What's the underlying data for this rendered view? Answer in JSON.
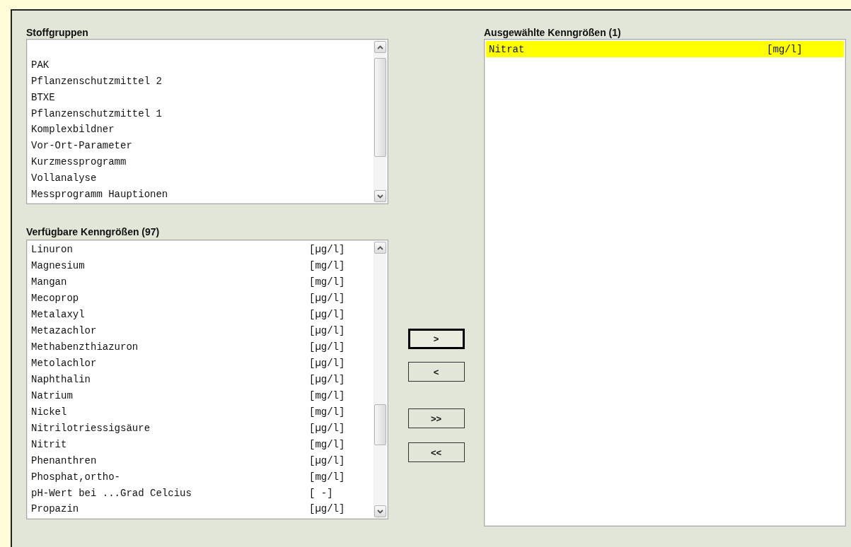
{
  "groups": {
    "title": "Stoffgruppen",
    "items": [
      {
        "name": "PAK",
        "selected": false
      },
      {
        "name": "Pflanzenschutzmittel 2",
        "selected": false
      },
      {
        "name": "BTXE",
        "selected": false
      },
      {
        "name": "Pflanzenschutzmittel 1",
        "selected": false
      },
      {
        "name": "Komplexbildner",
        "selected": false
      },
      {
        "name": "Vor-Ort-Parameter",
        "selected": false
      },
      {
        "name": "Kurzmessprogramm",
        "selected": false
      },
      {
        "name": "Vollanalyse",
        "selected": false
      },
      {
        "name": "Messprogramm Hauptionen",
        "selected": false
      }
    ]
  },
  "available": {
    "title": "Verfügbare Kenngrößen (97)",
    "items": [
      {
        "name": "Linuron",
        "unit": "[µg/l]",
        "selected": false
      },
      {
        "name": "Magnesium",
        "unit": "[mg/l]",
        "selected": false
      },
      {
        "name": "Mangan",
        "unit": "[mg/l]",
        "selected": false
      },
      {
        "name": "Mecoprop",
        "unit": "[µg/l]",
        "selected": false
      },
      {
        "name": "Metalaxyl",
        "unit": "[µg/l]",
        "selected": false
      },
      {
        "name": "Metazachlor",
        "unit": "[µg/l]",
        "selected": false
      },
      {
        "name": "Methabenzthiazuron",
        "unit": "[µg/l]",
        "selected": false
      },
      {
        "name": "Metolachlor",
        "unit": "[µg/l]",
        "selected": false
      },
      {
        "name": "Naphthalin",
        "unit": "[µg/l]",
        "selected": false
      },
      {
        "name": "Natrium",
        "unit": "[mg/l]",
        "selected": false
      },
      {
        "name": "Nickel",
        "unit": "[mg/l]",
        "selected": false
      },
      {
        "name": "Nitrilotriessigsäure",
        "unit": "[µg/l]",
        "selected": false
      },
      {
        "name": "Nitrit",
        "unit": "[mg/l]",
        "selected": false
      },
      {
        "name": "Phenanthren",
        "unit": "[µg/l]",
        "selected": false
      },
      {
        "name": "Phosphat,ortho-",
        "unit": "[mg/l]",
        "selected": false
      },
      {
        "name": "pH-Wert bei ...Grad Celcius",
        "unit": "[ -]",
        "selected": false
      },
      {
        "name": "Propazin",
        "unit": "[µg/l]",
        "selected": false
      }
    ]
  },
  "transfer_buttons": [
    {
      "label": ">",
      "focused": true
    },
    {
      "label": "<",
      "focused": false
    },
    {
      "label": ">>",
      "focused": false
    },
    {
      "label": "<<",
      "focused": false
    }
  ],
  "selected_list": {
    "title": "Ausgewählte Kenngrößen (1)",
    "items": [
      {
        "name": "Nitrat",
        "unit": "[mg/l]",
        "selected": true
      }
    ]
  }
}
